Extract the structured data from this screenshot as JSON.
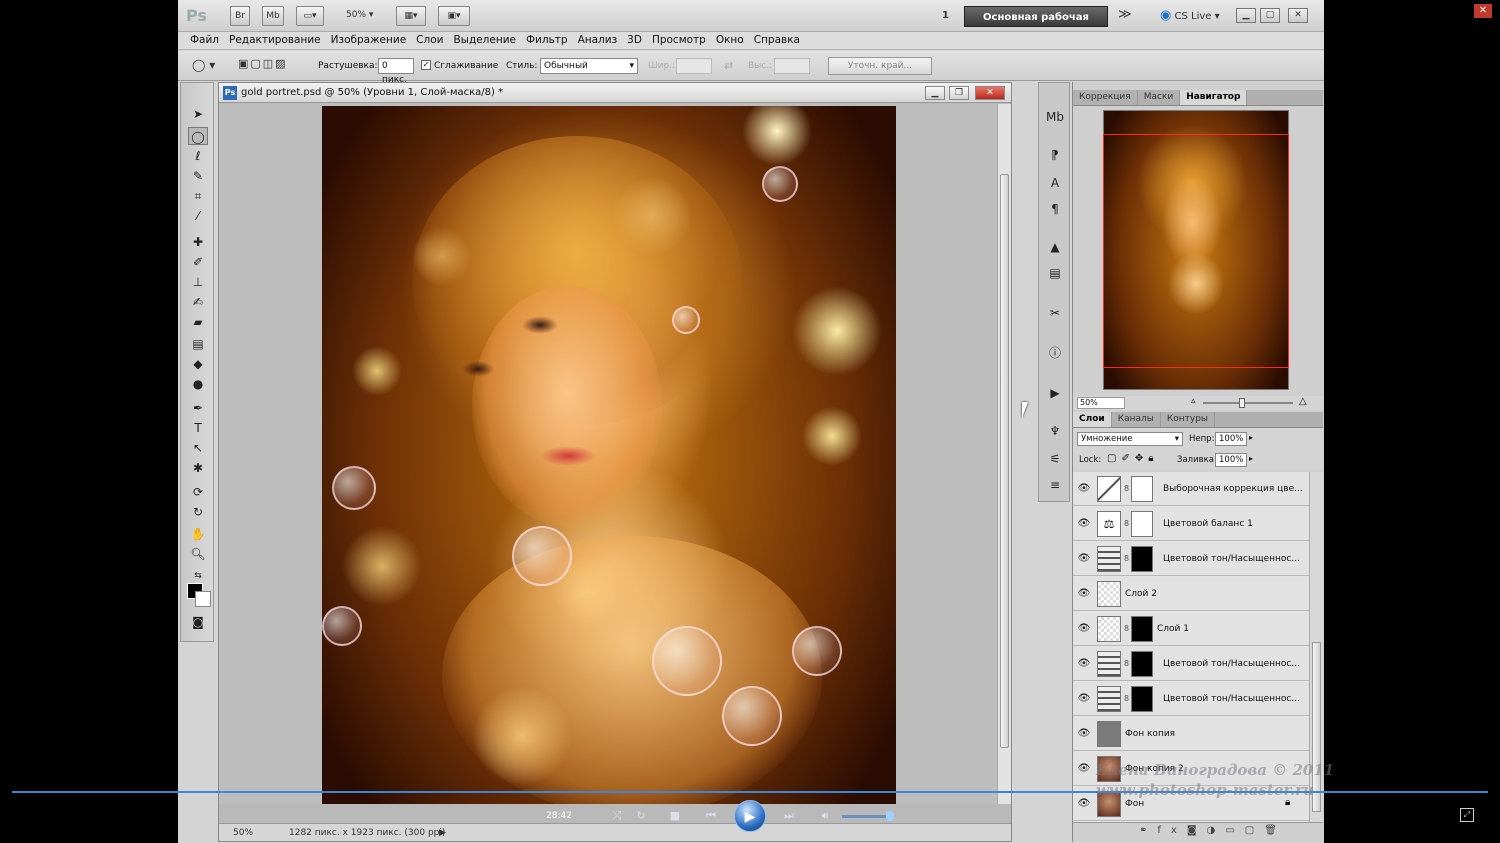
{
  "app": {
    "logo": "Ps",
    "bridge": "Br",
    "minibridge": "Mb",
    "zoom_level": "50%",
    "doc_count": "1",
    "workspace": "Основная рабочая среда",
    "more": "≫",
    "cs_live": "CS Live"
  },
  "menu": [
    "Файл",
    "Редактирование",
    "Изображение",
    "Слои",
    "Выделение",
    "Фильтр",
    "Анализ",
    "3D",
    "Просмотр",
    "Окно",
    "Справка"
  ],
  "options": {
    "feather_label": "Растушевка:",
    "feather_value": "0 пикс.",
    "antialias_label": "Сглаживание",
    "style_label": "Стиль:",
    "style_value": "Обычный",
    "width_label": "Шир.:",
    "height_label": "Выс.:",
    "refine_edge": "Уточн. край..."
  },
  "document": {
    "ps_badge": "Ps",
    "title": "gold portret.psd @ 50% (Уровни 1, Слой-маска/8) *",
    "status_zoom": "50%",
    "status_info": "1282 пикс. x 1923 пикс. (300 ppi)"
  },
  "panels": {
    "top_tabs": [
      "Коррекция",
      "Маски",
      "Навигатор"
    ],
    "nav_zoom": "50%",
    "layer_tabs": [
      "Слои",
      "Каналы",
      "Контуры"
    ],
    "blend_mode": "Умножение",
    "opacity_label": "Непр:",
    "opacity_value": "100%",
    "lock_label": "Lock:",
    "fill_label": "Заливка:",
    "fill_value": "100%"
  },
  "layers": [
    {
      "name": "Выборочная коррекция цве...",
      "thumb": "adjust",
      "mask": "white"
    },
    {
      "name": "Цветовой баланс 1",
      "thumb": "balance",
      "mask": "white"
    },
    {
      "name": "Цветовой тон/Насыщеннос...",
      "thumb": "hue",
      "mask": "black"
    },
    {
      "name": "Слой 2",
      "thumb": "transparent",
      "mask": "none"
    },
    {
      "name": "Слой 1",
      "thumb": "transparent",
      "mask": "black"
    },
    {
      "name": "Цветовой тон/Насыщеннос...",
      "thumb": "hue",
      "mask": "black"
    },
    {
      "name": "Цветовой тон/Насыщеннос...",
      "thumb": "hue",
      "mask": "black"
    },
    {
      "name": "Фон копия",
      "thumb": "gray",
      "mask": "none"
    },
    {
      "name": "Фон копия 2",
      "thumb": "photo",
      "mask": "none"
    },
    {
      "name": "Фон",
      "thumb": "photo",
      "mask": "none"
    }
  ],
  "player": {
    "time": "28:42"
  },
  "watermark": {
    "line1": "Елена Виноградова © 2011",
    "line2": "www.photoshop-master.ru"
  },
  "colors": {
    "accent": "#3a86d8",
    "workspace_btn": "#4a4a4a",
    "nav_rect": "#ff2a1a"
  }
}
